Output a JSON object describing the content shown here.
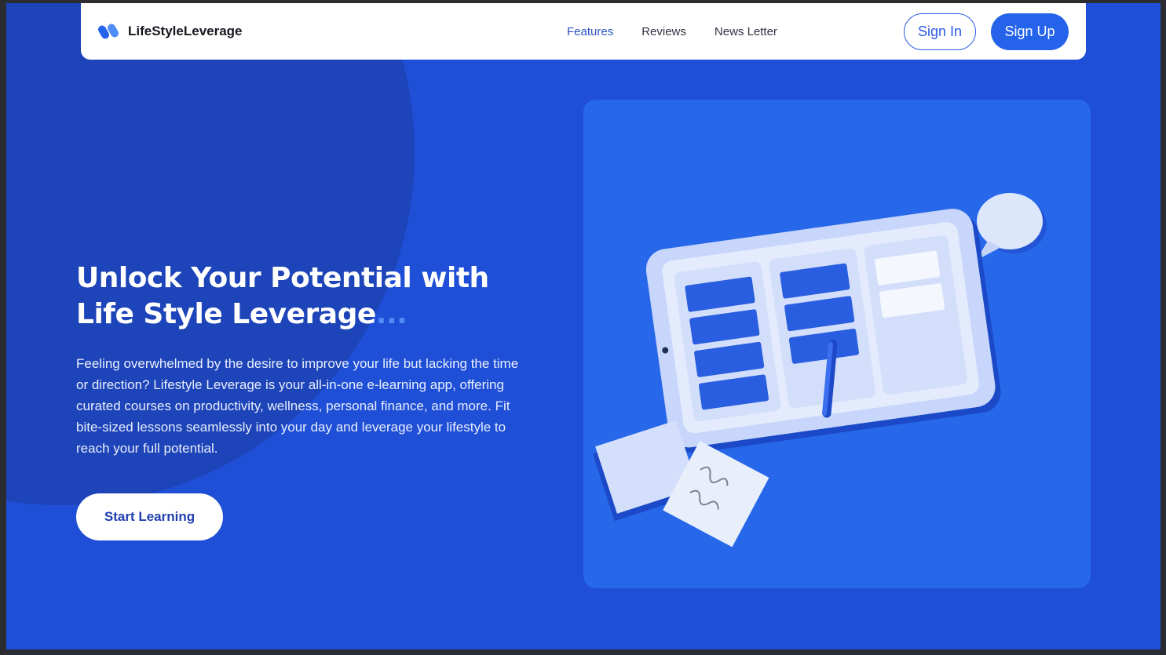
{
  "brand": {
    "name": "LifeStyleLeverage",
    "logo_icon": "lifestyle-leverage-logo-icon"
  },
  "nav": {
    "links": [
      {
        "label": "Features",
        "active": true
      },
      {
        "label": "Reviews",
        "active": false
      },
      {
        "label": "News Letter",
        "active": false
      }
    ],
    "signin_label": "Sign In",
    "signup_label": "Sign Up"
  },
  "hero": {
    "title_line1": "Unlock Your Potential with",
    "title_line2": "Life Style Leverage",
    "title_dots": "...",
    "description": "Feeling overwhelmed by the desire to improve your life but lacking the time or direction? Lifestyle Leverage is your all-in-one e-learning app, offering curated courses on productivity, wellness, personal finance, and more. Fit bite-sized lessons seamlessly into your day and leverage your lifestyle to reach your full potential.",
    "cta_label": "Start Learning"
  },
  "illustration": {
    "icon": "tablet-kanban-board-illustration",
    "elements": [
      "tablet-icon",
      "stylus-icon",
      "speech-bubble-icon",
      "sticky-notes-icon"
    ]
  },
  "colors": {
    "background": "#1f4fd6",
    "accent": "#2563eb",
    "card": "#2767ea",
    "dots": "#4f8df7"
  }
}
